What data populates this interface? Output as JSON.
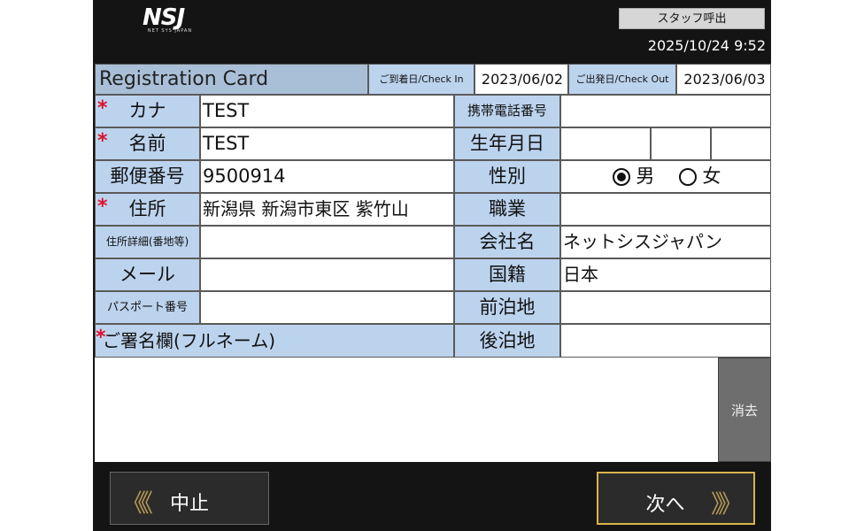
{
  "header": {
    "logo_text": "NSJ",
    "logo_sub": "NET SYS JAPAN",
    "staff_call_label": "スタッフ呼出",
    "datetime": "2025/10/24 9:52"
  },
  "card": {
    "title": "Registration Card",
    "checkin_label": "ご到着日/Check In",
    "checkin_value": "2023/06/02",
    "checkout_label": "ご出発日/Check Out",
    "checkout_value": "2023/06/03"
  },
  "left_fields": [
    {
      "label": "カナ",
      "value": "TEST",
      "required": "*"
    },
    {
      "label": "名前",
      "value": "TEST",
      "required": "*"
    },
    {
      "label": "郵便番号",
      "value": "9500914"
    },
    {
      "label": "住所",
      "value": "新潟県 新潟市東区 紫竹山",
      "required": "*"
    },
    {
      "label": "住所詳細(番地等)",
      "value": ""
    },
    {
      "label": "メール",
      "value": ""
    },
    {
      "label": "パスポート番号",
      "value": ""
    }
  ],
  "right_fields": {
    "phone_label": "携帯電話番号",
    "phone_value": "",
    "birth_label": "生年月日",
    "gender_label": "性別",
    "gender_male": "男",
    "gender_female": "女",
    "gender_selected": "男",
    "job_label": "職業",
    "job_value": "",
    "company_label": "会社名",
    "company_value": "ネットシスジャパン",
    "nationality_label": "国籍",
    "nationality_value": "日本",
    "prev_stay_label": "前泊地",
    "prev_stay_value": "",
    "next_stay_label": "後泊地",
    "next_stay_value": ""
  },
  "signature": {
    "label": "ご署名欄(フルネーム)",
    "required": "*",
    "clear_label": "消去"
  },
  "footer": {
    "cancel_label": "中止",
    "next_label": "次へ",
    "back_chevrons": "《《",
    "next_chevrons": "》》"
  }
}
